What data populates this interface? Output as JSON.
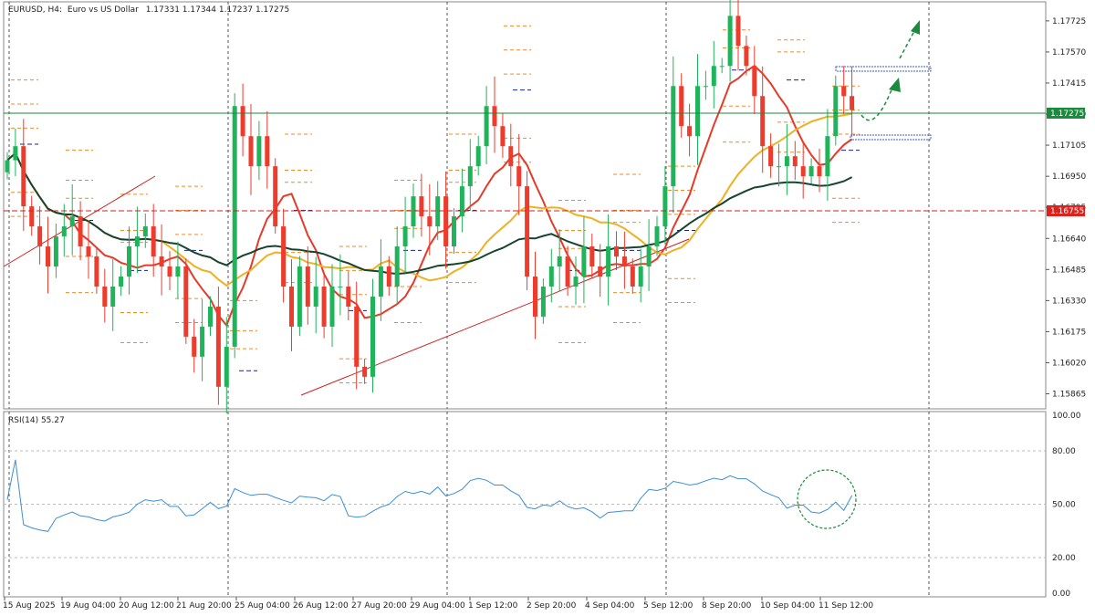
{
  "header": {
    "symbol": "EURUSD, H4:",
    "description": "Euro vs US Dollar",
    "ohlc": "1.17331 1.17344 1.17237 1.17275"
  },
  "rsi_label": "RSI(14) 55.27",
  "price_tags": {
    "current": {
      "label": "1.17275",
      "value": 1.17275,
      "color": "#1a8a3c"
    },
    "red_line": {
      "label": "1.16755",
      "value": 1.16755,
      "color": "#e0201b"
    }
  },
  "colors": {
    "bull": "#1fb35a",
    "bear": "#ef3b2c",
    "ma_fast": "#e53a2a",
    "ma_mid": "#f0b020",
    "ma_slow": "#15452e",
    "rsi": "#3a8ed8",
    "trend": "#cc2222",
    "projection": "#1a8a3c",
    "pivot_orange": "#f08a24",
    "pivot_navy": "#1a237e",
    "zone": "#3d5ae0"
  },
  "chart_data": [
    {
      "type": "candlestick",
      "symbol": "EURUSD",
      "timeframe": "H4",
      "ylim": [
        1.1579,
        1.1782
      ],
      "y_ticks": [
        "1.17725",
        "1.17570",
        "1.17415",
        "1.17260",
        "1.17105",
        "1.16950",
        "1.16795",
        "1.16640",
        "1.16485",
        "1.16330",
        "1.16175",
        "1.16020",
        "1.15865"
      ],
      "x_ticks": [
        "15 Aug 2025",
        "19 Aug 04:00",
        "20 Aug 12:00",
        "21 Aug 20:00",
        "25 Aug 04:00",
        "26 Aug 12:00",
        "27 Aug 20:00",
        "29 Aug 04:00",
        "1 Sep 12:00",
        "2 Sep 20:00",
        "4 Sep 04:00",
        "5 Sep 12:00",
        "8 Sep 20:00",
        "10 Sep 04:00",
        "11 Sep 12:00"
      ],
      "close": [
        1.1703,
        1.171,
        1.168,
        1.167,
        1.166,
        1.165,
        1.1665,
        1.167,
        1.1675,
        1.166,
        1.1655,
        1.164,
        1.163,
        1.164,
        1.1645,
        1.166,
        1.1665,
        1.167,
        1.1655,
        1.165,
        1.1645,
        1.165,
        1.1615,
        1.1605,
        1.162,
        1.163,
        1.159,
        1.161,
        1.173,
        1.1715,
        1.17,
        1.1715,
        1.17,
        1.167,
        1.164,
        1.162,
        1.165,
        1.163,
        1.164,
        1.162,
        1.164,
        1.164,
        1.163,
        1.16,
        1.1595,
        1.1635,
        1.165,
        1.164,
        1.166,
        1.167,
        1.1685,
        1.1675,
        1.167,
        1.1685,
        1.166,
        1.1675,
        1.169,
        1.17,
        1.171,
        1.173,
        1.172,
        1.171,
        1.17,
        1.169,
        1.1645,
        1.1625,
        1.164,
        1.165,
        1.1655,
        1.164,
        1.1645,
        1.166,
        1.165,
        1.1645,
        1.166,
        1.1655,
        1.165,
        1.164,
        1.165,
        1.166,
        1.167,
        1.169,
        1.174,
        1.172,
        1.1715,
        1.174,
        1.174,
        1.175,
        1.175,
        1.1775,
        1.176,
        1.175,
        1.1735,
        1.171,
        1.17,
        1.17,
        1.1705,
        1.17,
        1.1695,
        1.17,
        1.1695,
        1.1715,
        1.174,
        1.1735,
        1.1728
      ],
      "series": [
        {
          "name": "",
          "kind": "ma-fast"
        },
        {
          "name": "",
          "kind": "ma-mid"
        },
        {
          "name": "",
          "kind": "ma-slow"
        }
      ],
      "grid": "dashed vertical"
    },
    {
      "type": "line",
      "ylim": [
        0,
        100
      ],
      "y_ticks": [
        "100.00",
        "80.00",
        "50.00",
        "20.00",
        "0.00"
      ],
      "levels": [
        80,
        50,
        20
      ],
      "values": [
        55.27
      ]
    }
  ]
}
